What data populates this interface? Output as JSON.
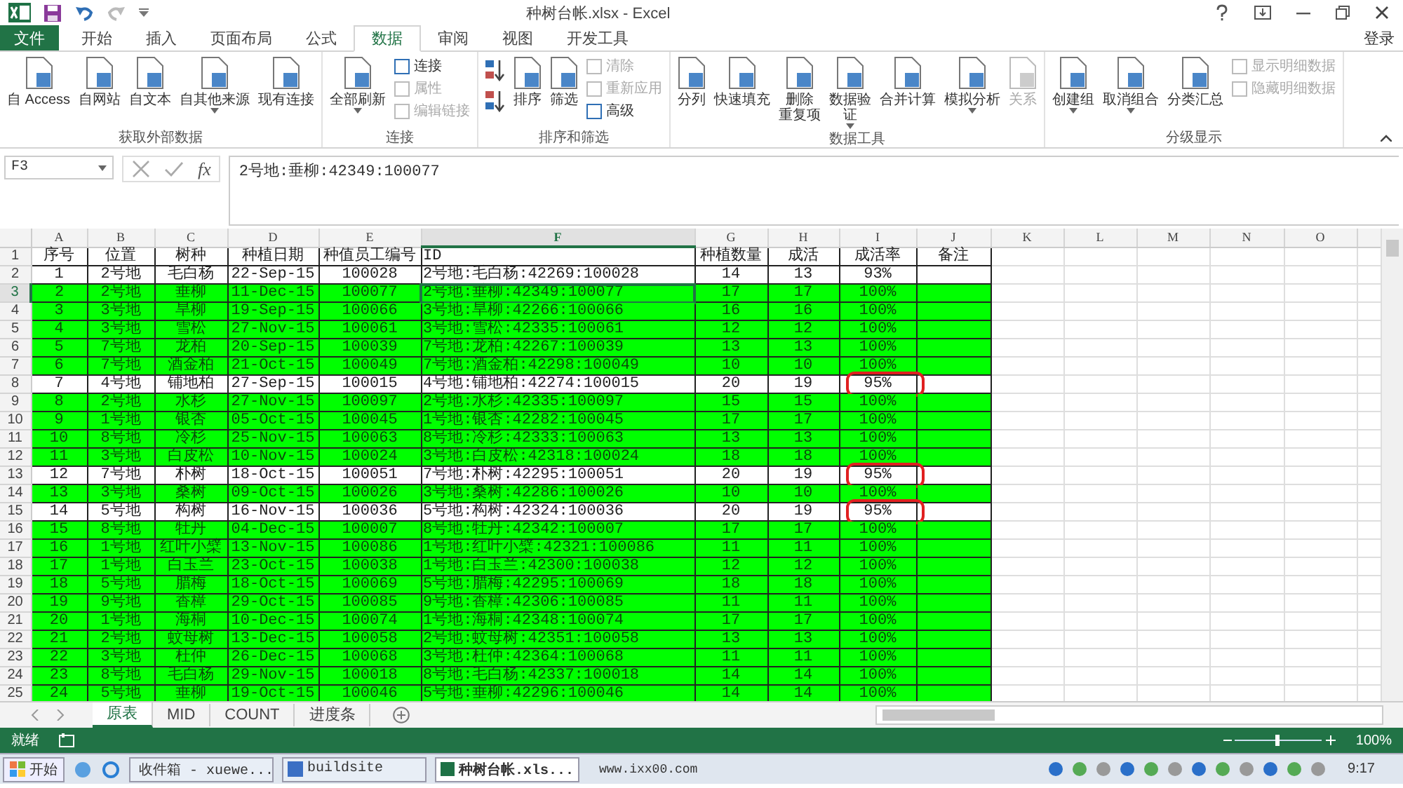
{
  "title_bar": {
    "title": "种树台帐.xlsx - Excel"
  },
  "ribbon_tabs": [
    {
      "label": "文件",
      "kind": "file",
      "selected": false
    },
    {
      "label": "开始",
      "kind": "tab",
      "selected": false
    },
    {
      "label": "插入",
      "kind": "tab",
      "selected": false
    },
    {
      "label": "页面布局",
      "kind": "tab",
      "selected": false
    },
    {
      "label": "公式",
      "kind": "tab",
      "selected": false
    },
    {
      "label": "数据",
      "kind": "tab",
      "selected": true
    },
    {
      "label": "审阅",
      "kind": "tab",
      "selected": false
    },
    {
      "label": "视图",
      "kind": "tab",
      "selected": false
    },
    {
      "label": "开发工具",
      "kind": "tab",
      "selected": false
    }
  ],
  "account": "登录",
  "ribbon_groups": [
    {
      "name": "获取外部数据",
      "buttons": [
        {
          "label": "自 Access",
          "kind": "large",
          "disabled": false,
          "dropdown": false
        },
        {
          "label": "自网站",
          "kind": "large",
          "disabled": false,
          "dropdown": false
        },
        {
          "label": "自文本",
          "kind": "large",
          "disabled": false,
          "dropdown": false
        },
        {
          "label": "自其他来源",
          "kind": "large",
          "disabled": false,
          "dropdown": true
        },
        {
          "label": "现有连接",
          "kind": "large",
          "disabled": false,
          "dropdown": false
        }
      ]
    },
    {
      "name": "连接",
      "buttons": [
        {
          "label": "全部刷新",
          "kind": "large",
          "disabled": false,
          "dropdown": true
        },
        {
          "label": "连接",
          "kind": "small",
          "disabled": false
        },
        {
          "label": "属性",
          "kind": "small",
          "disabled": true
        },
        {
          "label": "编辑链接",
          "kind": "small",
          "disabled": true
        }
      ]
    },
    {
      "name": "排序和筛选",
      "buttons": [
        {
          "kind": "sort-up",
          "disabled": false
        },
        {
          "kind": "sort-down",
          "disabled": false
        },
        {
          "label": "排序",
          "kind": "large",
          "disabled": false,
          "dropdown": false
        },
        {
          "label": "筛选",
          "kind": "large",
          "disabled": false,
          "dropdown": false
        },
        {
          "label": "清除",
          "kind": "small",
          "disabled": true
        },
        {
          "label": "重新应用",
          "kind": "small",
          "disabled": true
        },
        {
          "label": "高级",
          "kind": "small",
          "disabled": false
        }
      ]
    },
    {
      "name": "数据工具",
      "buttons": [
        {
          "label": "分列",
          "kind": "large",
          "disabled": false,
          "dropdown": false
        },
        {
          "label": "快速填充",
          "kind": "large",
          "disabled": false,
          "dropdown": false
        },
        {
          "lines": [
            "删除",
            "重复项"
          ],
          "kind": "large",
          "disabled": false,
          "dropdown": false
        },
        {
          "lines": [
            "数据验",
            "证"
          ],
          "kind": "large",
          "disabled": false,
          "dropdown": true
        },
        {
          "label": "合并计算",
          "kind": "large",
          "disabled": false,
          "dropdown": false
        },
        {
          "label": "模拟分析",
          "kind": "large",
          "disabled": false,
          "dropdown": true
        },
        {
          "label": "关系",
          "kind": "large",
          "disabled": true,
          "dropdown": false
        }
      ]
    },
    {
      "name": "分级显示",
      "buttons": [
        {
          "label": "创建组",
          "kind": "large",
          "disabled": false,
          "dropdown": true
        },
        {
          "label": "取消组合",
          "kind": "large",
          "disabled": false,
          "dropdown": true
        },
        {
          "label": "分类汇总",
          "kind": "large",
          "disabled": false,
          "dropdown": false
        },
        {
          "label": "显示明细数据",
          "kind": "small",
          "disabled": true
        },
        {
          "label": "隐藏明细数据",
          "kind": "small",
          "disabled": true
        }
      ]
    }
  ],
  "name_box": "F3",
  "formula_icon": "fx",
  "formula": "2号地:垂柳:42349:100077",
  "columns": [
    {
      "letter": "A",
      "selected": false
    },
    {
      "letter": "B",
      "selected": false
    },
    {
      "letter": "C",
      "selected": false
    },
    {
      "letter": "D",
      "selected": false
    },
    {
      "letter": "E",
      "selected": false
    },
    {
      "letter": "F",
      "selected": true
    },
    {
      "letter": "G",
      "selected": false
    },
    {
      "letter": "H",
      "selected": false
    },
    {
      "letter": "I",
      "selected": false
    },
    {
      "letter": "J",
      "selected": false
    },
    {
      "letter": "K",
      "selected": false
    },
    {
      "letter": "L",
      "selected": false
    },
    {
      "letter": "M",
      "selected": false
    },
    {
      "letter": "N",
      "selected": false
    },
    {
      "letter": "O",
      "selected": false
    }
  ],
  "rows": [
    {
      "number": "1",
      "selected": false,
      "highlighted": false,
      "circled": false,
      "cells": [
        "序号",
        "位置",
        "树种",
        "种植日期",
        "种值员工编号",
        "ID",
        "种植数量",
        "成活",
        "成活率",
        "备注"
      ]
    },
    {
      "number": "2",
      "selected": false,
      "highlighted": false,
      "circled": false,
      "cells": [
        "1",
        "2号地",
        "毛白杨",
        "22-Sep-15",
        "100028",
        "2号地:毛白杨:42269:100028",
        "14",
        "13",
        "93%"
      ]
    },
    {
      "number": "3",
      "selected": true,
      "highlighted": true,
      "circled": false,
      "cells": [
        "2",
        "2号地",
        "垂柳",
        "11-Dec-15",
        "100077",
        "2号地:垂柳:42349:100077",
        "17",
        "17",
        "100%"
      ]
    },
    {
      "number": "4",
      "selected": false,
      "highlighted": true,
      "circled": false,
      "cells": [
        "3",
        "3号地",
        "旱柳",
        "19-Sep-15",
        "100066",
        "3号地:旱柳:42266:100066",
        "16",
        "16",
        "100%"
      ]
    },
    {
      "number": "5",
      "selected": false,
      "highlighted": true,
      "circled": false,
      "cells": [
        "4",
        "3号地",
        "雪松",
        "27-Nov-15",
        "100061",
        "3号地:雪松:42335:100061",
        "12",
        "12",
        "100%"
      ]
    },
    {
      "number": "6",
      "selected": false,
      "highlighted": true,
      "circled": false,
      "cells": [
        "5",
        "7号地",
        "龙柏",
        "20-Sep-15",
        "100039",
        "7号地:龙柏:42267:100039",
        "13",
        "13",
        "100%"
      ]
    },
    {
      "number": "7",
      "selected": false,
      "highlighted": true,
      "circled": false,
      "cells": [
        "6",
        "7号地",
        "酒金柏",
        "21-Oct-15",
        "100049",
        "7号地:酒金柏:42298:100049",
        "10",
        "10",
        "100%"
      ]
    },
    {
      "number": "8",
      "selected": false,
      "highlighted": false,
      "circled": true,
      "cells": [
        "7",
        "4号地",
        "铺地柏",
        "27-Sep-15",
        "100015",
        "4号地:铺地柏:42274:100015",
        "20",
        "19",
        "95%"
      ]
    },
    {
      "number": "9",
      "selected": false,
      "highlighted": true,
      "circled": false,
      "cells": [
        "8",
        "2号地",
        "水杉",
        "27-Nov-15",
        "100097",
        "2号地:水杉:42335:100097",
        "15",
        "15",
        "100%"
      ]
    },
    {
      "number": "10",
      "selected": false,
      "highlighted": true,
      "circled": false,
      "cells": [
        "9",
        "1号地",
        "银杏",
        "05-Oct-15",
        "100045",
        "1号地:银杏:42282:100045",
        "17",
        "17",
        "100%"
      ]
    },
    {
      "number": "11",
      "selected": false,
      "highlighted": true,
      "circled": false,
      "cells": [
        "10",
        "8号地",
        "冷杉",
        "25-Nov-15",
        "100063",
        "8号地:冷杉:42333:100063",
        "13",
        "13",
        "100%"
      ]
    },
    {
      "number": "12",
      "selected": false,
      "highlighted": true,
      "circled": false,
      "cells": [
        "11",
        "3号地",
        "白皮松",
        "10-Nov-15",
        "100024",
        "3号地:白皮松:42318:100024",
        "18",
        "18",
        "100%"
      ]
    },
    {
      "number": "13",
      "selected": false,
      "highlighted": false,
      "circled": true,
      "cells": [
        "12",
        "7号地",
        "朴树",
        "18-Oct-15",
        "100051",
        "7号地:朴树:42295:100051",
        "20",
        "19",
        "95%"
      ]
    },
    {
      "number": "14",
      "selected": false,
      "highlighted": true,
      "circled": false,
      "cells": [
        "13",
        "3号地",
        "桑树",
        "09-Oct-15",
        "100026",
        "3号地:桑树:42286:100026",
        "10",
        "10",
        "100%"
      ]
    },
    {
      "number": "15",
      "selected": false,
      "highlighted": false,
      "circled": true,
      "cells": [
        "14",
        "5号地",
        "构树",
        "16-Nov-15",
        "100036",
        "5号地:构树:42324:100036",
        "20",
        "19",
        "95%"
      ]
    },
    {
      "number": "16",
      "selected": false,
      "highlighted": true,
      "circled": false,
      "cells": [
        "15",
        "8号地",
        "牡丹",
        "04-Dec-15",
        "100007",
        "8号地:牡丹:42342:100007",
        "17",
        "17",
        "100%"
      ]
    },
    {
      "number": "17",
      "selected": false,
      "highlighted": true,
      "circled": false,
      "cells": [
        "16",
        "1号地",
        "红叶小檗",
        "13-Nov-15",
        "100086",
        "1号地:红叶小檗:42321:100086",
        "11",
        "11",
        "100%"
      ]
    },
    {
      "number": "18",
      "selected": false,
      "highlighted": true,
      "circled": false,
      "cells": [
        "17",
        "1号地",
        "白玉兰",
        "23-Oct-15",
        "100038",
        "1号地:白玉兰:42300:100038",
        "12",
        "12",
        "100%"
      ]
    },
    {
      "number": "19",
      "selected": false,
      "highlighted": true,
      "circled": false,
      "cells": [
        "18",
        "5号地",
        "腊梅",
        "18-Oct-15",
        "100069",
        "5号地:腊梅:42295:100069",
        "18",
        "18",
        "100%"
      ]
    },
    {
      "number": "20",
      "selected": false,
      "highlighted": true,
      "circled": false,
      "cells": [
        "19",
        "9号地",
        "香樟",
        "29-Oct-15",
        "100085",
        "9号地:香樟:42306:100085",
        "11",
        "11",
        "100%"
      ]
    },
    {
      "number": "21",
      "selected": false,
      "highlighted": true,
      "circled": false,
      "cells": [
        "20",
        "1号地",
        "海桐",
        "10-Dec-15",
        "100074",
        "1号地:海桐:42348:100074",
        "17",
        "17",
        "100%"
      ]
    },
    {
      "number": "22",
      "selected": false,
      "highlighted": true,
      "circled": false,
      "cells": [
        "21",
        "2号地",
        "蚊母树",
        "13-Dec-15",
        "100058",
        "2号地:蚊母树:42351:100058",
        "13",
        "13",
        "100%"
      ]
    },
    {
      "number": "23",
      "selected": false,
      "highlighted": true,
      "circled": false,
      "cells": [
        "22",
        "3号地",
        "杜仲",
        "26-Dec-15",
        "100068",
        "3号地:杜仲:42364:100068",
        "11",
        "11",
        "100%"
      ]
    },
    {
      "number": "24",
      "selected": false,
      "highlighted": true,
      "circled": false,
      "cells": [
        "23",
        "8号地",
        "毛白杨",
        "29-Nov-15",
        "100018",
        "8号地:毛白杨:42337:100018",
        "14",
        "14",
        "100%"
      ]
    },
    {
      "number": "25",
      "selected": false,
      "highlighted": true,
      "circled": false,
      "cells": [
        "24",
        "5号地",
        "垂柳",
        "19-Oct-15",
        "100046",
        "5号地:垂柳:42296:100046",
        "14",
        "14",
        "100%"
      ]
    }
  ],
  "sheet_tabs": [
    {
      "label": "原表",
      "selected": true
    },
    {
      "label": "MID",
      "selected": false
    },
    {
      "label": "COUNT",
      "selected": false
    },
    {
      "label": "进度条",
      "selected": false
    }
  ],
  "status": {
    "text": "就绪",
    "zoom": "100%"
  },
  "taskbar": {
    "start": "开始",
    "windows": [
      {
        "label": "收件箱 - xuewe...",
        "selected": false
      },
      {
        "label": "buildsite",
        "selected": false
      },
      {
        "label": "种树台帐.xls...",
        "selected": true
      }
    ],
    "address": "www.ixx00.com",
    "time": "9:17"
  }
}
